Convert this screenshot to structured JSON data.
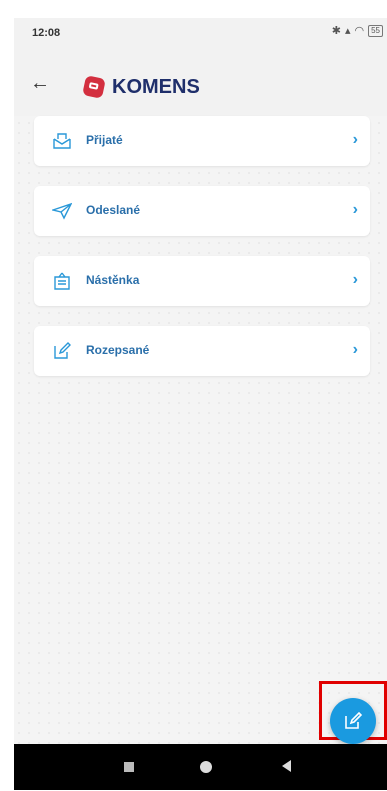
{
  "status": {
    "time": "12:08",
    "battery": "55"
  },
  "appbar": {
    "title": "KOMENS"
  },
  "menu": [
    {
      "label": "Přijaté",
      "icon": "inbox-icon"
    },
    {
      "label": "Odeslané",
      "icon": "paper-plane-icon"
    },
    {
      "label": "Nástěnka",
      "icon": "bulletin-board-icon"
    },
    {
      "label": "Rozepsané",
      "icon": "edit-icon"
    }
  ],
  "colors": {
    "accent": "#1a9ae0",
    "title": "#1f2f6b",
    "logo": "#d32f3f",
    "highlight": "#e00000"
  }
}
